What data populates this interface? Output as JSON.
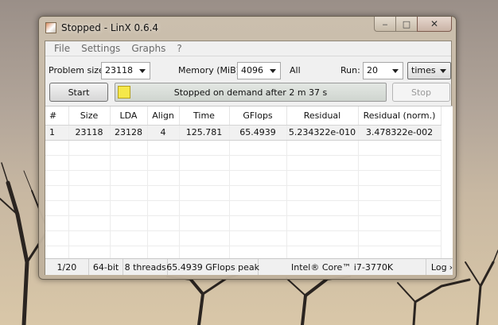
{
  "window": {
    "title": "Stopped - LinX 0.6.4"
  },
  "caption": {
    "minimize": "‒",
    "maximize": "□",
    "close": "✕"
  },
  "menu": [
    "File",
    "Settings",
    "Graphs",
    "?"
  ],
  "controls": {
    "problem_size_label": "Problem size:",
    "problem_size_value": "23118",
    "memory_label": "Memory (MiB):",
    "memory_value": "4096",
    "all_label": "All",
    "run_label": "Run:",
    "run_value": "20",
    "run_unit": "times"
  },
  "actions": {
    "start_label": "Start",
    "stop_label": "Stop",
    "progress_text": "Stopped on demand after 2 m 37 s"
  },
  "table": {
    "columns": [
      "#",
      "Size",
      "LDA",
      "Align",
      "Time",
      "GFlops",
      "Residual",
      "Residual (norm.)"
    ],
    "rows": [
      [
        "1",
        "23118",
        "23128",
        "4",
        "125.781",
        "65.4939",
        "5.234322e-010",
        "3.478322e-002"
      ]
    ]
  },
  "status": {
    "runs": "1/20",
    "bits": "64-bit",
    "threads": "8 threads",
    "peak": "65.4939 GFlops peak",
    "cpu": "Intel® Core™ i7-3770K",
    "log_label": "Log",
    "log_arrow": "›"
  },
  "colors": {
    "indicator": "#f5e84a",
    "window_frame": "#cdc1af"
  }
}
